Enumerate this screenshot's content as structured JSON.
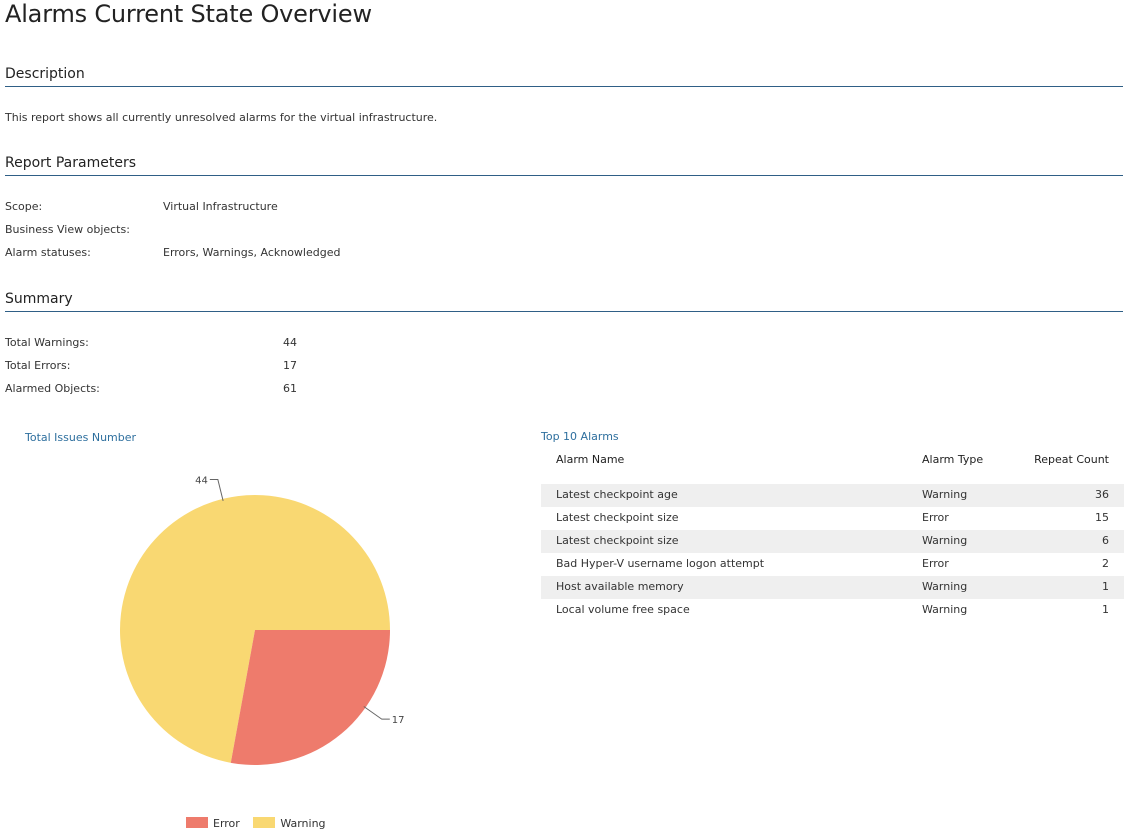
{
  "title": "Alarms Current State Overview",
  "description": {
    "heading": "Description",
    "text": "This report shows all currently unresolved alarms for the virtual infrastructure."
  },
  "parameters": {
    "heading": "Report Parameters",
    "items": [
      {
        "label": "Scope:",
        "value": "Virtual Infrastructure"
      },
      {
        "label": "Business View objects:",
        "value": ""
      },
      {
        "label": "Alarm statuses:",
        "value": "Errors, Warnings, Acknowledged"
      }
    ]
  },
  "summary": {
    "heading": "Summary",
    "items": [
      {
        "label": "Total Warnings:",
        "value": "44"
      },
      {
        "label": "Total Errors:",
        "value": "17"
      },
      {
        "label": "Alarmed Objects:",
        "value": "61"
      }
    ]
  },
  "chart_data": [
    {
      "type": "pie",
      "title": "Total Issues Number",
      "categories": [
        "Error",
        "Warning"
      ],
      "values": [
        17,
        44
      ],
      "labels": [
        "17",
        "44"
      ],
      "colors": [
        "#ee7b6c",
        "#f9d872"
      ],
      "legend": "bottom-center"
    },
    {
      "type": "table",
      "title": "Top 10 Alarms",
      "columns": [
        "Alarm Name",
        "Alarm Type",
        "Repeat Count"
      ],
      "rows": [
        [
          "Latest checkpoint age",
          "Warning",
          "36"
        ],
        [
          "Latest checkpoint size",
          "Error",
          "15"
        ],
        [
          "Latest checkpoint size",
          "Warning",
          "6"
        ],
        [
          "Bad Hyper-V username logon attempt",
          "Error",
          "2"
        ],
        [
          "Host available memory",
          "Warning",
          "1"
        ],
        [
          "Local volume free space",
          "Warning",
          "1"
        ]
      ]
    }
  ]
}
